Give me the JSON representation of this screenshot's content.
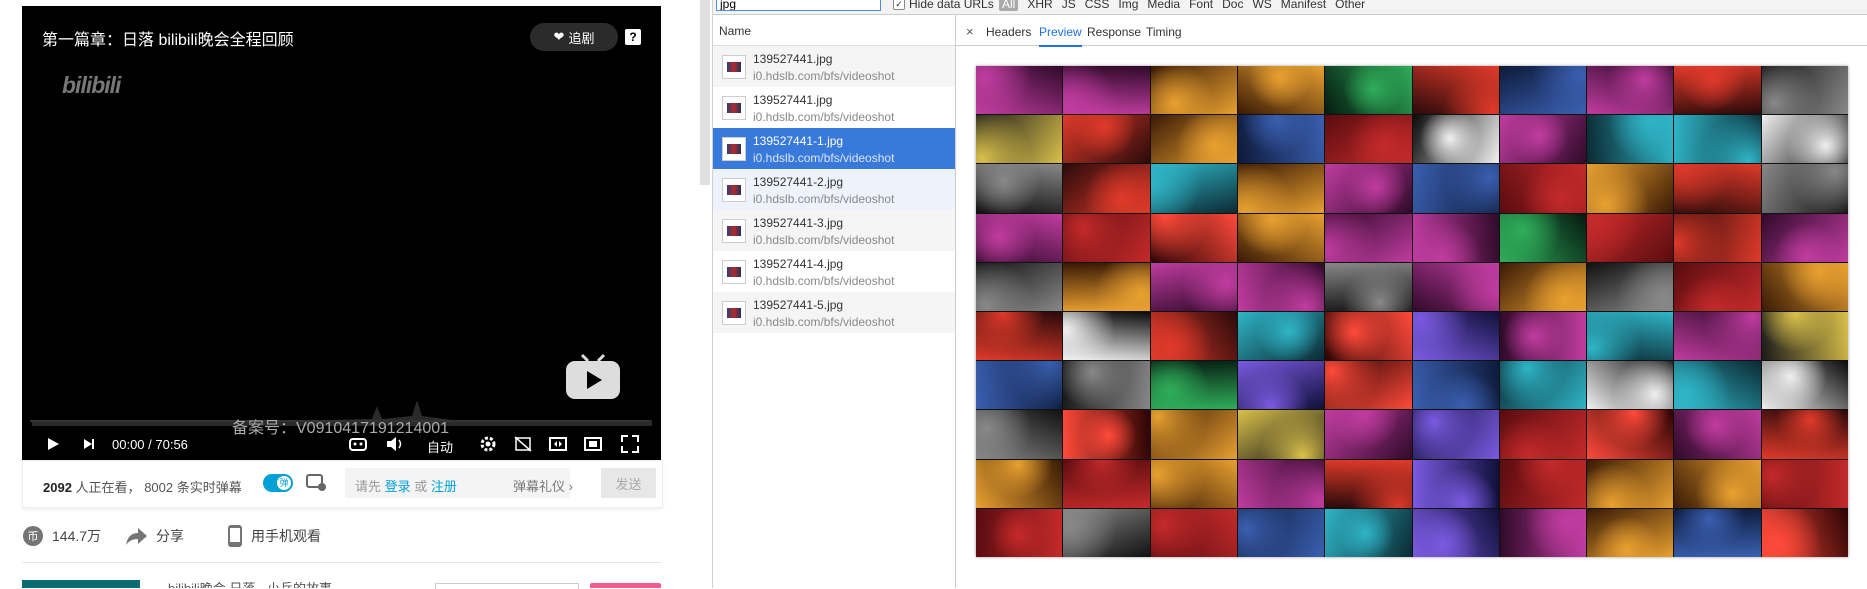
{
  "player": {
    "title": "第一篇章：日落 bilibili晚会全程回顾",
    "follow_label": "追剧",
    "help_label": "?",
    "watermark": "bilibili",
    "icp": "备案号：V0910417191214001",
    "time": "00:00 / 70:56",
    "auto_label": "自动"
  },
  "under_bar": {
    "viewers_count": "2092",
    "viewers_text": "人正在看，",
    "danmaku_count": "8002",
    "danmaku_text": "条实时弹幕",
    "toggle_label": "弹",
    "input_prefix": "请先",
    "login": "登录",
    "or": "或",
    "register": "注册",
    "gift": "弹幕礼仪",
    "send": "发送"
  },
  "actions": {
    "coins": "144.7万",
    "share": "分享",
    "mobile": "用手机观看"
  },
  "next_title": "bilibili晚会 日落 · 小兵的故事",
  "devtools": {
    "filter_value": "jpg",
    "hide_data_urls": "Hide data URLs",
    "type_filters": [
      "All",
      "XHR",
      "JS",
      "CSS",
      "Img",
      "Media",
      "Font",
      "Doc",
      "WS",
      "Manifest",
      "Other"
    ],
    "name_header": "Name",
    "requests": [
      {
        "name": "139527441.jpg",
        "url": "i0.hdslb.com/bfs/videoshot"
      },
      {
        "name": "139527441.jpg",
        "url": "i0.hdslb.com/bfs/videoshot"
      },
      {
        "name": "139527441-1.jpg",
        "url": "i0.hdslb.com/bfs/videoshot"
      },
      {
        "name": "139527441-2.jpg",
        "url": "i0.hdslb.com/bfs/videoshot"
      },
      {
        "name": "139527441-3.jpg",
        "url": "i0.hdslb.com/bfs/videoshot"
      },
      {
        "name": "139527441-4.jpg",
        "url": "i0.hdslb.com/bfs/videoshot"
      },
      {
        "name": "139527441-5.jpg",
        "url": "i0.hdslb.com/bfs/videoshot"
      }
    ],
    "selected_request": 2,
    "tabs": [
      "Headers",
      "Preview",
      "Response",
      "Timing"
    ],
    "active_tab": "Preview",
    "close": "×"
  },
  "colors": {
    "accent": "#00a1d6",
    "selected_row": "#3879d9",
    "pink": "#f25d8e"
  }
}
